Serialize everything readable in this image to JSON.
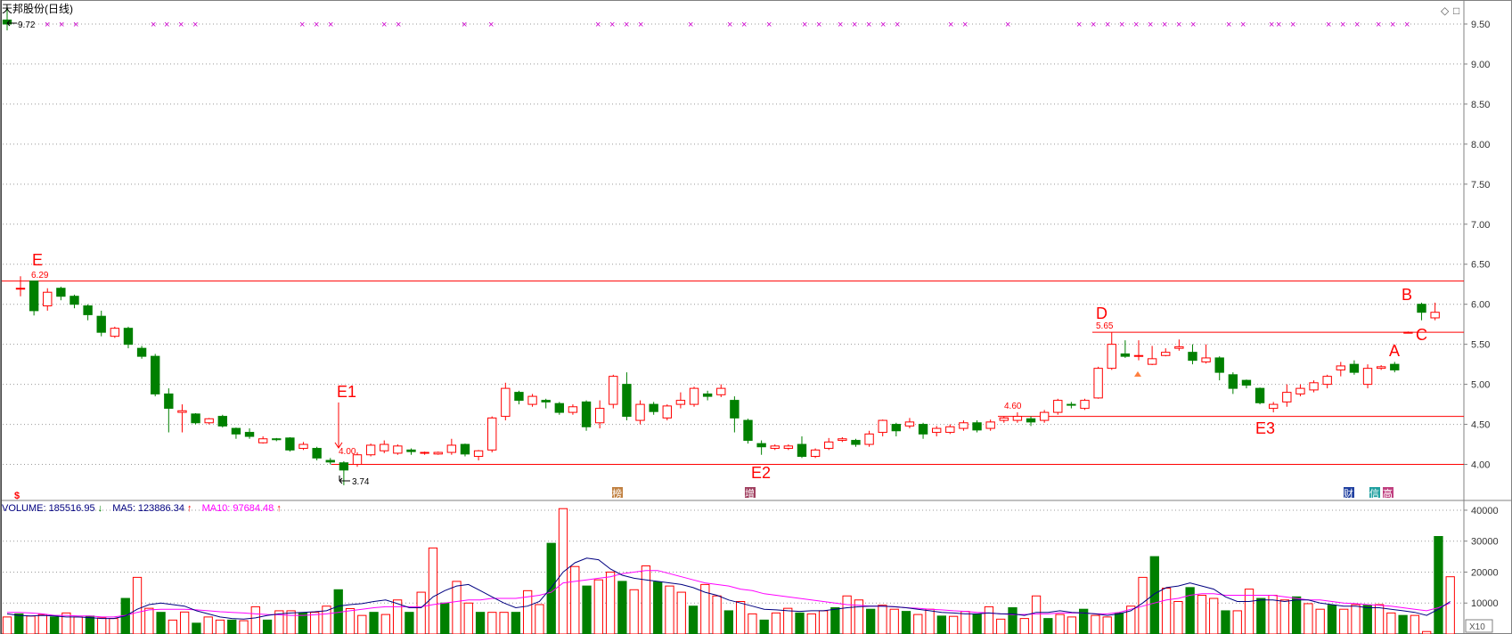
{
  "title": "天邦股份(日线)",
  "corner_icons": {
    "diamond": "◇",
    "window": "□"
  },
  "price_axis": {
    "ticks": [
      "9.50",
      "9.00",
      "8.50",
      "8.00",
      "7.50",
      "7.00",
      "6.50",
      "6.00",
      "5.50",
      "5.00",
      "4.50",
      "4.00"
    ],
    "tick_values": [
      9.5,
      9.0,
      8.5,
      8.0,
      7.5,
      7.0,
      6.5,
      6.0,
      5.5,
      5.0,
      4.5,
      4.0
    ],
    "ylim": [
      3.55,
      9.8
    ]
  },
  "volume_axis": {
    "ticks": [
      "40000",
      "30000",
      "20000",
      "10000"
    ],
    "tick_values": [
      40000,
      30000,
      20000,
      10000
    ],
    "ylim": [
      0,
      42000
    ],
    "multiplier": "X10"
  },
  "volume_header": {
    "volume_label": "VOLUME: 185516.95",
    "volume_arrow": "↓",
    "ma5_label": "MA5: 123886.34",
    "ma5_arrow": "↑",
    "ma10_label": "MA10: 97684.48",
    "ma10_arrow": "↑"
  },
  "colors": {
    "up": "#ff0000",
    "down": "#008000",
    "ma5": "#000080",
    "ma10": "#ff00ff",
    "grid": "#999999",
    "marker": "#cc00cc"
  },
  "chart_data": {
    "type": "candlestick",
    "num_days": 108,
    "first_candle": {
      "open": 9.55,
      "close": 9.5,
      "high": 9.72,
      "low": 9.42
    },
    "candles": [
      [
        6.2,
        6.2,
        6.35,
        6.1
      ],
      [
        6.29,
        5.92,
        6.29,
        5.86
      ],
      [
        5.98,
        6.15,
        6.2,
        5.92
      ],
      [
        6.2,
        6.1,
        6.22,
        6.05
      ],
      [
        6.1,
        6.0,
        6.12,
        5.95
      ],
      [
        5.98,
        5.87,
        6.0,
        5.8
      ],
      [
        5.85,
        5.65,
        5.92,
        5.6
      ],
      [
        5.6,
        5.7,
        5.72,
        5.58
      ],
      [
        5.7,
        5.5,
        5.72,
        5.45
      ],
      [
        5.45,
        5.35,
        5.48,
        5.32
      ],
      [
        5.35,
        4.88,
        5.38,
        4.85
      ],
      [
        4.88,
        4.7,
        4.95,
        4.4
      ],
      [
        4.65,
        4.67,
        4.75,
        4.4
      ],
      [
        4.63,
        4.52,
        4.64,
        4.5
      ],
      [
        4.52,
        4.57,
        4.58,
        4.5
      ],
      [
        4.6,
        4.48,
        4.62,
        4.46
      ],
      [
        4.45,
        4.38,
        4.46,
        4.32
      ],
      [
        4.4,
        4.35,
        4.45,
        4.32
      ],
      [
        4.27,
        4.32,
        4.35,
        4.26
      ],
      [
        4.32,
        4.31,
        4.33,
        4.29
      ],
      [
        4.33,
        4.18,
        4.34,
        4.16
      ],
      [
        4.2,
        4.25,
        4.28,
        4.18
      ],
      [
        4.2,
        4.08,
        4.22,
        4.05
      ],
      [
        4.05,
        4.03,
        4.08,
        4.0
      ],
      [
        4.02,
        3.93,
        4.04,
        3.74
      ],
      [
        4.0,
        4.12,
        4.15,
        3.97
      ],
      [
        4.12,
        4.24,
        4.26,
        4.1
      ],
      [
        4.17,
        4.25,
        4.3,
        4.14
      ],
      [
        4.14,
        4.23,
        4.25,
        4.12
      ],
      [
        4.18,
        4.16,
        4.2,
        4.12
      ],
      [
        4.14,
        4.15,
        4.16,
        4.12
      ],
      [
        4.13,
        4.15,
        4.16,
        4.12
      ],
      [
        4.15,
        4.24,
        4.32,
        4.12
      ],
      [
        4.25,
        4.13,
        4.26,
        4.1
      ],
      [
        4.1,
        4.17,
        4.18,
        4.05
      ],
      [
        4.18,
        4.58,
        4.6,
        4.15
      ],
      [
        4.6,
        4.95,
        5.02,
        4.55
      ],
      [
        4.9,
        4.8,
        4.92,
        4.75
      ],
      [
        4.75,
        4.85,
        4.88,
        4.72
      ],
      [
        4.8,
        4.78,
        4.82,
        4.7
      ],
      [
        4.76,
        4.65,
        4.78,
        4.62
      ],
      [
        4.65,
        4.72,
        4.75,
        4.62
      ],
      [
        4.78,
        4.47,
        4.8,
        4.42
      ],
      [
        4.52,
        4.7,
        4.8,
        4.45
      ],
      [
        4.75,
        5.1,
        5.12,
        4.7
      ],
      [
        5.0,
        4.6,
        5.15,
        4.55
      ],
      [
        4.55,
        4.75,
        4.8,
        4.5
      ],
      [
        4.75,
        4.66,
        4.78,
        4.62
      ],
      [
        4.58,
        4.73,
        4.75,
        4.55
      ],
      [
        4.75,
        4.8,
        4.9,
        4.7
      ],
      [
        4.75,
        4.95,
        4.97,
        4.72
      ],
      [
        4.88,
        4.85,
        4.92,
        4.8
      ],
      [
        4.87,
        4.95,
        5.0,
        4.84
      ],
      [
        4.8,
        4.58,
        4.85,
        4.4
      ],
      [
        4.55,
        4.3,
        4.57,
        4.26
      ],
      [
        4.26,
        4.22,
        4.3,
        4.12
      ],
      [
        4.2,
        4.23,
        4.25,
        4.18
      ],
      [
        4.2,
        4.23,
        4.25,
        4.18
      ],
      [
        4.25,
        4.1,
        4.35,
        4.08
      ],
      [
        4.1,
        4.18,
        4.2,
        4.08
      ],
      [
        4.2,
        4.28,
        4.33,
        4.18
      ],
      [
        4.3,
        4.32,
        4.34,
        4.28
      ],
      [
        4.3,
        4.25,
        4.32,
        4.22
      ],
      [
        4.25,
        4.38,
        4.42,
        4.22
      ],
      [
        4.4,
        4.55,
        4.56,
        4.35
      ],
      [
        4.5,
        4.42,
        4.52,
        4.35
      ],
      [
        4.48,
        4.53,
        4.58,
        4.45
      ],
      [
        4.5,
        4.38,
        4.52,
        4.32
      ],
      [
        4.4,
        4.45,
        4.48,
        4.35
      ],
      [
        4.4,
        4.47,
        4.5,
        4.38
      ],
      [
        4.45,
        4.52,
        4.55,
        4.42
      ],
      [
        4.52,
        4.43,
        4.55,
        4.4
      ],
      [
        4.45,
        4.53,
        4.56,
        4.42
      ],
      [
        4.55,
        4.58,
        4.6,
        4.52
      ],
      [
        4.55,
        4.6,
        4.65,
        4.52
      ],
      [
        4.57,
        4.53,
        4.6,
        4.48
      ],
      [
        4.55,
        4.65,
        4.68,
        4.52
      ],
      [
        4.65,
        4.8,
        4.82,
        4.62
      ],
      [
        4.75,
        4.74,
        4.78,
        4.7
      ],
      [
        4.7,
        4.8,
        4.82,
        4.68
      ],
      [
        4.83,
        5.2,
        5.22,
        4.82
      ],
      [
        5.2,
        5.5,
        5.65,
        5.18
      ],
      [
        5.38,
        5.35,
        5.55,
        5.33
      ],
      [
        5.35,
        5.36,
        5.55,
        5.3
      ],
      [
        5.25,
        5.32,
        5.48,
        5.24
      ],
      [
        5.36,
        5.4,
        5.45,
        5.35
      ],
      [
        5.45,
        5.47,
        5.56,
        5.42
      ],
      [
        5.4,
        5.3,
        5.5,
        5.25
      ],
      [
        5.28,
        5.33,
        5.5,
        5.26
      ],
      [
        5.33,
        5.15,
        5.35,
        5.05
      ],
      [
        5.12,
        4.95,
        5.15,
        4.88
      ],
      [
        5.05,
        4.99,
        5.06,
        4.95
      ],
      [
        4.95,
        4.77,
        4.96,
        4.75
      ],
      [
        4.7,
        4.75,
        4.78,
        4.65
      ],
      [
        4.78,
        4.9,
        5.0,
        4.72
      ],
      [
        4.88,
        4.95,
        5.0,
        4.85
      ],
      [
        4.93,
        5.02,
        5.05,
        4.9
      ],
      [
        5.0,
        5.1,
        5.12,
        4.95
      ],
      [
        5.18,
        5.23,
        5.28,
        5.1
      ],
      [
        5.25,
        5.15,
        5.3,
        5.12
      ],
      [
        5.0,
        5.2,
        5.25,
        4.95
      ],
      [
        5.2,
        5.22,
        5.24,
        5.18
      ],
      [
        5.25,
        5.18,
        5.28,
        5.15
      ],
      [
        5.65,
        5.65,
        5.66,
        5.64
      ],
      [
        6.0,
        5.9,
        6.02,
        5.8
      ],
      [
        5.83,
        5.9,
        6.02,
        5.8
      ]
    ],
    "volume": [
      5.5,
      6.5,
      5.8,
      6.3,
      5.5,
      6.8,
      5.5,
      5.8,
      5.2,
      5.0,
      11.5,
      18.3,
      8.3,
      7.0,
      4.5,
      7.1,
      3.5,
      5.5,
      4.5,
      4.5,
      4.3,
      8.8,
      4.5,
      7.5,
      7.5,
      6.8,
      7.0,
      9.0,
      14.3,
      8.2,
      6.0,
      7.0,
      6.3,
      11.0,
      7.0,
      13.5,
      27.8,
      10.0,
      17.0,
      10.0,
      7.0,
      7.0,
      7.0,
      7.0,
      14.0,
      9.5,
      29.3,
      40.5,
      21.8,
      15.5,
      17.5,
      20.0,
      17.0,
      14.3,
      22.0,
      16.8,
      15.5,
      13.5,
      9.0,
      16.0,
      12.3,
      7.5,
      10.5,
      6.5,
      4.5,
      6.8,
      8.3,
      6.8,
      6.5,
      7.5,
      8.5,
      12.3,
      11.0,
      8.0,
      9.3,
      8.0,
      7.3,
      6.3,
      8.0,
      5.8,
      5.7,
      7.3,
      6.3,
      8.8,
      4.8,
      8.5,
      5.0,
      12.3,
      5.0,
      6.3,
      5.5,
      8.0,
      6.0,
      5.5,
      6.8,
      9.0,
      18.3,
      25.0,
      14.8,
      10.5,
      15.0,
      12.5,
      11.5,
      7.5,
      7.5,
      14.5,
      11.5,
      12.5,
      11.0,
      12.0,
      9.8,
      8.0,
      9.3,
      8.0,
      9.5,
      9.3,
      9.5,
      6.8,
      6.0,
      6.0,
      0.8,
      31.5,
      18.5
    ],
    "volume_unit": "thousand (X10)",
    "ma5": [
      6.5,
      6.0,
      5.8,
      6.0,
      5.8,
      5.5,
      5.5,
      5.3,
      5.0,
      5.0,
      5.8,
      8.0,
      9.5,
      10.0,
      9.5,
      9.0,
      7.5,
      6.5,
      5.5,
      5.0,
      4.8,
      5.2,
      6.0,
      6.5,
      6.8,
      7.0,
      7.2,
      7.5,
      9.0,
      9.5,
      9.8,
      10.5,
      11.0,
      9.8,
      8.5,
      8.5,
      12.0,
      14.0,
      15.5,
      16.0,
      14.0,
      12.0,
      10.0,
      8.5,
      9.0,
      10.5,
      15.0,
      20.0,
      23.0,
      24.5,
      24.0,
      21.0,
      19.0,
      18.0,
      17.5,
      17.0,
      16.5,
      16.0,
      15.0,
      13.5,
      12.5,
      11.0,
      10.0,
      9.0,
      8.0,
      7.8,
      7.5,
      7.3,
      7.5,
      7.5,
      8.0,
      8.5,
      8.8,
      9.0,
      9.0,
      8.8,
      8.5,
      8.0,
      7.5,
      7.0,
      6.8,
      6.5,
      6.5,
      6.8,
      6.5,
      6.5,
      6.0,
      7.0,
      7.0,
      7.5,
      7.0,
      6.8,
      6.5,
      6.0,
      6.5,
      7.5,
      10.0,
      13.0,
      15.0,
      15.5,
      16.5,
      15.5,
      14.5,
      12.0,
      10.5,
      10.5,
      11.0,
      11.0,
      10.5,
      11.0,
      11.0,
      10.0,
      9.5,
      9.0,
      9.0,
      8.5,
      8.5,
      8.0,
      7.5,
      7.0,
      6.0,
      8.0,
      10.5
    ],
    "ma10": [
      7.0,
      7.0,
      6.8,
      6.5,
      6.0,
      6.0,
      5.8,
      5.8,
      5.5,
      5.5,
      6.0,
      7.0,
      7.8,
      8.0,
      8.0,
      8.0,
      7.8,
      7.5,
      7.2,
      7.0,
      6.8,
      6.5,
      6.3,
      6.2,
      6.0,
      6.0,
      6.2,
      6.5,
      7.0,
      7.5,
      8.0,
      8.5,
      8.8,
      8.8,
      8.8,
      8.8,
      9.5,
      10.0,
      10.5,
      11.0,
      11.0,
      11.5,
      11.5,
      11.5,
      12.0,
      12.5,
      13.5,
      16.5,
      17.0,
      17.5,
      18.0,
      18.5,
      19.5,
      20.0,
      20.5,
      20.5,
      19.5,
      18.5,
      17.5,
      16.5,
      16.0,
      15.5,
      14.5,
      14.0,
      13.0,
      12.5,
      12.0,
      11.5,
      11.0,
      10.5,
      10.0,
      9.5,
      9.3,
      9.0,
      9.0,
      8.8,
      8.5,
      8.3,
      8.0,
      7.8,
      7.5,
      7.3,
      7.0,
      6.8,
      6.5,
      6.3,
      6.3,
      6.5,
      6.5,
      6.8,
      6.8,
      6.8,
      6.5,
      6.5,
      7.0,
      8.0,
      9.0,
      10.0,
      11.0,
      11.5,
      12.5,
      13.0,
      13.0,
      12.5,
      12.5,
      12.5,
      12.5,
      12.5,
      12.0,
      11.5,
      11.0,
      11.0,
      10.5,
      10.0,
      9.8,
      9.5,
      9.3,
      9.0,
      8.5,
      8.0,
      7.5,
      8.5,
      10.0
    ],
    "hlines": [
      6.29,
      5.65,
      4.6,
      4.0
    ],
    "labels": {
      "E": "E",
      "E1": "E1",
      "E2": "E2",
      "E3": "E3",
      "D": "D",
      "A": "A",
      "B": "B",
      "C": "C",
      "p629": "6.29",
      "p565": "5.65",
      "p460": "4.60",
      "p400": "4.00",
      "p374": "3.74",
      "p972": "9.72"
    },
    "event_icons": {
      "first": "$",
      "bang": "榜",
      "zeng": "增",
      "cai": "财",
      "xin": "信",
      "gao": "高"
    },
    "marker_symbol": "×"
  }
}
